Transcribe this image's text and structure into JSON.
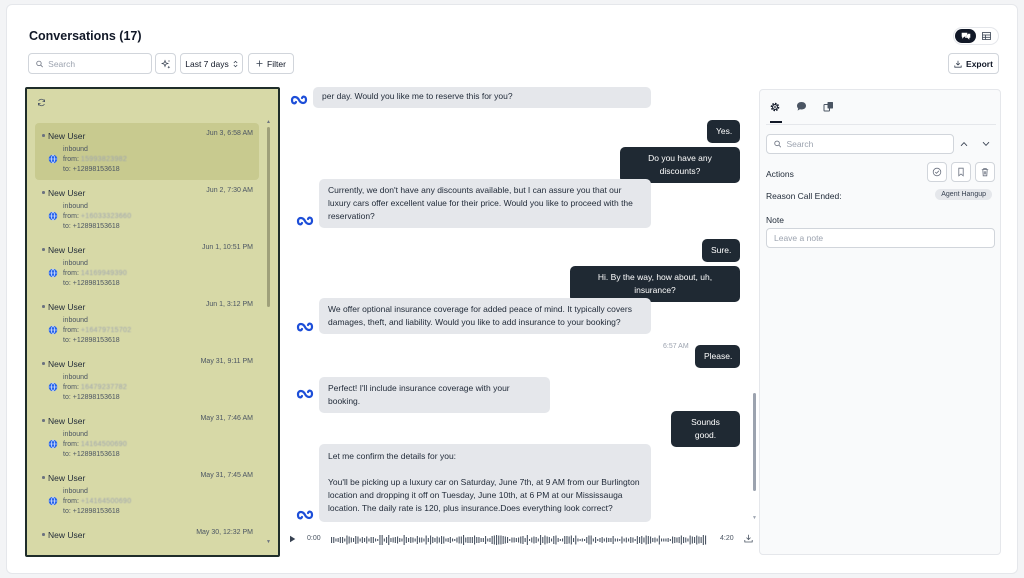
{
  "header": {
    "title": "Conversations (17)",
    "view_toggle": {
      "active": "conversation-view-icon",
      "inactive": "table-view-icon"
    }
  },
  "toolbar": {
    "search_placeholder": "Search",
    "date_range": "Last 7 days",
    "filter_label": "Filter",
    "export_label": "Export"
  },
  "conversations": [
    {
      "name": "New User",
      "time": "Jun 3, 6:58 AM",
      "direction": "inbound",
      "from_label": "from:",
      "from": "15993823982",
      "to": "to: +12898153618",
      "selected": true
    },
    {
      "name": "New User",
      "time": "Jun 2, 7:30 AM",
      "direction": "inbound",
      "from_label": "from:",
      "from": "+16033323660",
      "to": "to: +12898153618",
      "selected": false
    },
    {
      "name": "New User",
      "time": "Jun 1, 10:51 PM",
      "direction": "inbound",
      "from_label": "from:",
      "from": "14169949390",
      "to": "to: +12898153618",
      "selected": false
    },
    {
      "name": "New User",
      "time": "Jun 1, 3:12 PM",
      "direction": "inbound",
      "from_label": "from:",
      "from": "+16479715702",
      "to": "to: +12898153618",
      "selected": false
    },
    {
      "name": "New User",
      "time": "May 31, 9:11 PM",
      "direction": "inbound",
      "from_label": "from:",
      "from": "16479237782",
      "to": "to: +12898153618",
      "selected": false
    },
    {
      "name": "New User",
      "time": "May 31, 7:46 AM",
      "direction": "inbound",
      "from_label": "from:",
      "from": "14164500690",
      "to": "to: +12898153618",
      "selected": false
    },
    {
      "name": "New User",
      "time": "May 31, 7:45 AM",
      "direction": "inbound",
      "from_label": "from:",
      "from": "+14164500690",
      "to": "to: +12898153618",
      "selected": false
    },
    {
      "name": "New User",
      "time": "May 30, 12:32 PM",
      "direction": "",
      "from_label": "",
      "from": "",
      "to": "",
      "selected": false
    }
  ],
  "messages": {
    "m1": "per day. Would you like me to reserve this for you?",
    "m2": "Yes.",
    "m3": "Do you have any discounts?",
    "m4": "Currently, we don't have any discounts available, but I can assure you that our luxury cars offer excellent value for their price. Would you like to proceed with the reservation?",
    "m5": "Sure.",
    "m6": "Hi. By the way, how about, uh, insurance?",
    "m7": "We offer optional insurance coverage for added peace of mind. It typically covers damages, theft, and liability. Would you like to add insurance to your booking?",
    "m8_time": "6:57 AM",
    "m8": "Please.",
    "m9": "Perfect! I'll include insurance coverage with your booking.",
    "m10": "Sounds good.",
    "m11a": "Let me confirm the details for you:",
    "m11b": "You'll be picking up a luxury car on Saturday, June 7th, at 9 AM from our Burlington location and dropping it off on Tuesday, June 10th, at 6 PM at our Mississauga location. The daily rate is 120, plus insurance.Does everything look correct?"
  },
  "player": {
    "current": "0:00",
    "duration": "4:20",
    "progress": 0
  },
  "details": {
    "tabs": [
      "settings-gear-icon",
      "chat-bubble-icon",
      "copy-pages-icon"
    ],
    "search_placeholder": "Search",
    "actions_label": "Actions",
    "reason_label": "Reason Call Ended:",
    "reason_value": "Agent Hangup",
    "note_label": "Note",
    "note_placeholder": "Leave a note"
  },
  "colors": {
    "list_panel_bg": "#d7d9a7",
    "list_panel_border": "#1f2d2a",
    "user_bubble": "#1f2933",
    "bot_bubble": "#e5e7eb",
    "bot_avatar": "#1d4ed8"
  }
}
